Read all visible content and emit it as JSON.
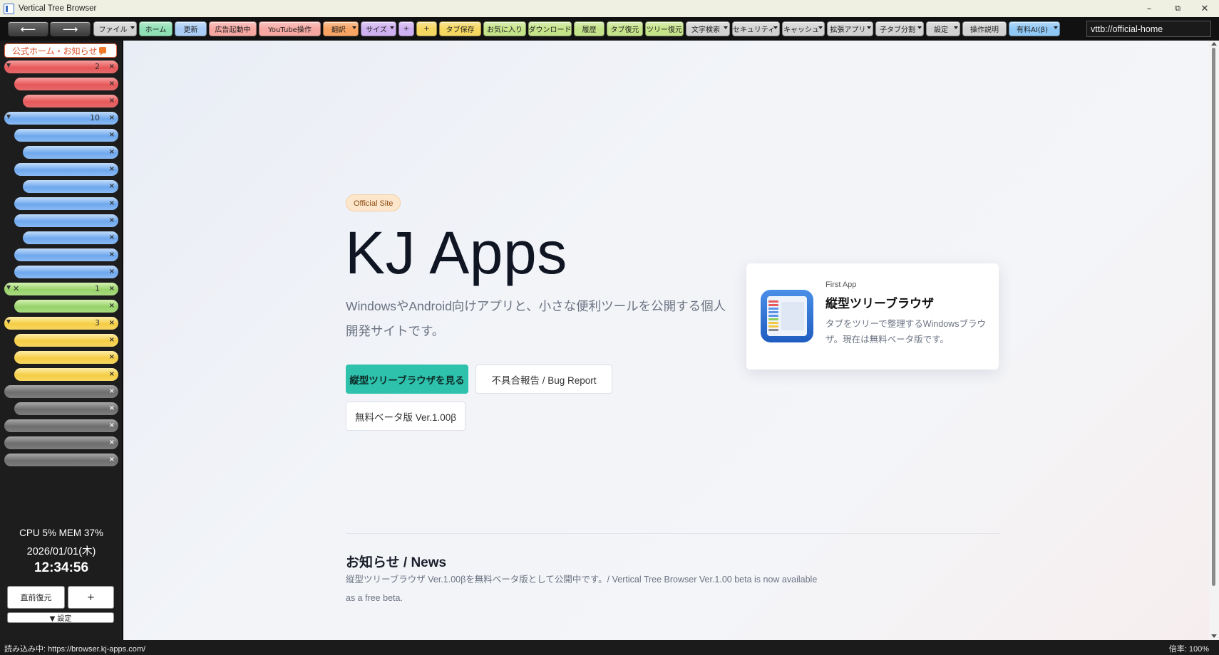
{
  "window": {
    "title": "Vertical Tree Browser",
    "minimize": "–",
    "restore": "⧉",
    "close": "✕"
  },
  "toolbar": {
    "back": "⟵",
    "forward": "⟶",
    "buttons": [
      {
        "label": "ファイル",
        "color": "#d2d2d2",
        "dropdown": true
      },
      {
        "label": "ホーム",
        "color": "#8fe0b4",
        "dropdown": false
      },
      {
        "label": "更新",
        "color": "#a9cdf5",
        "dropdown": false
      },
      {
        "label": "広告起動中",
        "color": "#f6a7a2",
        "dropdown": false
      },
      {
        "label": "YouTube操作",
        "color": "#f6a7a2",
        "dropdown": false
      },
      {
        "label": "翻訳",
        "color": "#f9a463",
        "dropdown": true
      },
      {
        "label": "サイズ",
        "color": "#cfb0f0",
        "dropdown": true
      },
      {
        "label": "+",
        "color": "#cfb0f0",
        "dropdown": false
      },
      {
        "label": "+",
        "color": "#f6d760",
        "dropdown": false
      },
      {
        "label": "タブ保存",
        "color": "#f6d760",
        "dropdown": false
      },
      {
        "label": "お気に入り",
        "color": "#c5e48a",
        "dropdown": false
      },
      {
        "label": "ダウンロード",
        "color": "#c5e48a",
        "dropdown": false
      },
      {
        "label": "履歴",
        "color": "#c5e48a",
        "dropdown": false
      },
      {
        "label": "タブ復元",
        "color": "#c5e48a",
        "dropdown": false
      },
      {
        "label": "ツリー復元",
        "color": "#c5e48a",
        "dropdown": false
      },
      {
        "label": "文字検索",
        "color": "#d2d2d2",
        "dropdown": true
      },
      {
        "label": "セキュリティ",
        "color": "#d2d2d2",
        "dropdown": true
      },
      {
        "label": "キャッシュ",
        "color": "#d2d2d2",
        "dropdown": true
      },
      {
        "label": "拡張アプリ",
        "color": "#d2d2d2",
        "dropdown": true
      },
      {
        "label": "子タブ分割",
        "color": "#d2d2d2",
        "dropdown": true
      },
      {
        "label": "設定",
        "color": "#d2d2d2",
        "dropdown": true
      },
      {
        "label": "操作説明",
        "color": "#d2d2d2",
        "dropdown": false
      },
      {
        "label": "有料AI(β)",
        "color": "#8fc8f5",
        "dropdown": true
      }
    ],
    "address": "vttb://official-home"
  },
  "sidebar": {
    "pinned_label": "公式ホーム・お知らせ",
    "tabs": [
      {
        "color": "red",
        "indent": 0,
        "twist": true,
        "mute": false,
        "count": "2"
      },
      {
        "color": "red",
        "indent": 1,
        "twist": false,
        "mute": false,
        "count": ""
      },
      {
        "color": "red",
        "indent": 2,
        "twist": false,
        "mute": false,
        "count": ""
      },
      {
        "color": "blue",
        "indent": 0,
        "twist": true,
        "mute": false,
        "count": "10"
      },
      {
        "color": "blue",
        "indent": 1,
        "twist": false,
        "mute": false,
        "count": ""
      },
      {
        "color": "blue",
        "indent": 2,
        "twist": false,
        "mute": false,
        "count": ""
      },
      {
        "color": "blue",
        "indent": 1,
        "twist": false,
        "mute": false,
        "count": ""
      },
      {
        "color": "blue",
        "indent": 2,
        "twist": false,
        "mute": false,
        "count": ""
      },
      {
        "color": "blue",
        "indent": 1,
        "twist": false,
        "mute": false,
        "count": ""
      },
      {
        "color": "blue",
        "indent": 1,
        "twist": false,
        "mute": false,
        "count": ""
      },
      {
        "color": "blue",
        "indent": 2,
        "twist": false,
        "mute": false,
        "count": ""
      },
      {
        "color": "blue",
        "indent": 1,
        "twist": false,
        "mute": false,
        "count": ""
      },
      {
        "color": "blue",
        "indent": 1,
        "twist": false,
        "mute": false,
        "count": ""
      },
      {
        "color": "green",
        "indent": 0,
        "twist": true,
        "mute": true,
        "count": "1"
      },
      {
        "color": "green",
        "indent": 1,
        "twist": false,
        "mute": false,
        "count": ""
      },
      {
        "color": "yellow",
        "indent": 0,
        "twist": true,
        "mute": false,
        "count": "3"
      },
      {
        "color": "yellow",
        "indent": 1,
        "twist": false,
        "mute": false,
        "count": ""
      },
      {
        "color": "yellow",
        "indent": 1,
        "twist": false,
        "mute": false,
        "count": ""
      },
      {
        "color": "yellow",
        "indent": 1,
        "twist": false,
        "mute": false,
        "count": ""
      },
      {
        "color": "gray",
        "indent": 0,
        "twist": false,
        "mute": false,
        "count": ""
      },
      {
        "color": "gray",
        "indent": 1,
        "twist": false,
        "mute": false,
        "count": ""
      },
      {
        "color": "gray",
        "indent": 0,
        "twist": false,
        "mute": false,
        "count": ""
      },
      {
        "color": "gray",
        "indent": 0,
        "twist": false,
        "mute": false,
        "count": ""
      },
      {
        "color": "gray",
        "indent": 0,
        "twist": false,
        "mute": false,
        "count": ""
      }
    ],
    "close_glyph": "×",
    "mute_glyph": "✕",
    "cpu_mem": "CPU 5%   MEM 37%",
    "date": "2026/01/01(木)",
    "clock": "12:34:56",
    "restore_button": "直前復元",
    "add_button": "+",
    "settings_button": "▼ 設定"
  },
  "page": {
    "badge": "Official Site",
    "title": "KJ Apps",
    "description": "WindowsやAndroid向けアプリと、小さな便利ツールを公開する個人開発サイトです。",
    "primary_button": "縦型ツリーブラウザを見る",
    "bug_button": "不具合報告 / Bug Report",
    "beta_button": "無料ベータ版 Ver.1.00β",
    "card": {
      "kicker": "First App",
      "name": "縦型ツリーブラウザ",
      "description": "タブをツリーで整理するWindowsブラウザ。現在は無料ベータ版です。"
    },
    "news_title": "お知らせ / News",
    "news_body": "縦型ツリーブラウザ Ver.1.00βを無料ベータ版として公開中です。/ Vertical Tree Browser Ver.1.00 beta is now available as a free beta."
  },
  "status": {
    "left": "読み込み中: https://browser.kj-apps.com/",
    "right": "倍率: 100%"
  }
}
